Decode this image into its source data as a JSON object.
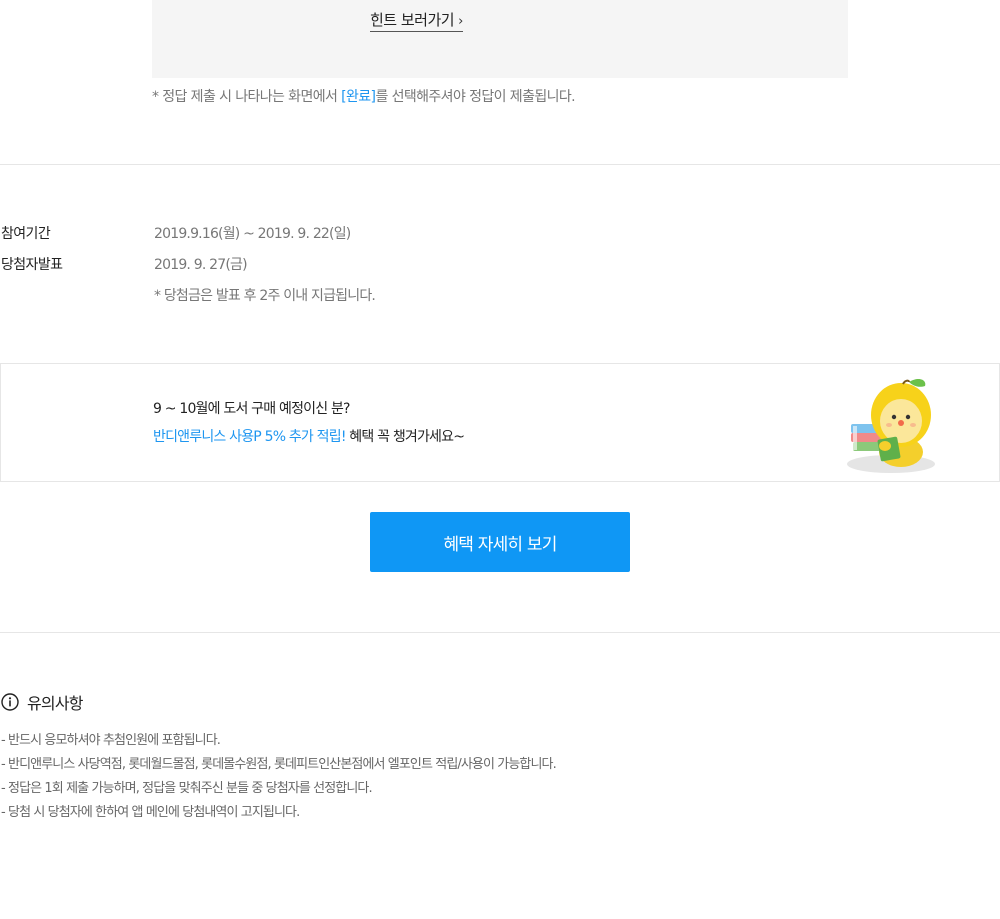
{
  "hint": {
    "link_label": "힌트 보러가기",
    "link_icon": "chevron-right-icon"
  },
  "submit_note": {
    "prefix": "* 정답 제출 시 나타나는 화면에서 ",
    "highlight": "[완료]",
    "suffix": "를 선택해주셔야 정답이 제출됩니다."
  },
  "schedule": {
    "period_label": "참여기간",
    "period_value": "2019.9.16(월) ~ 2019. 9. 22(일)",
    "announce_label": "당첨자발표",
    "announce_value": "2019. 9. 27(금)",
    "prize_note": "* 당첨금은 발표 후 2주 이내 지급됩니다."
  },
  "banner": {
    "line1": "9 ~ 10월에 도서 구매 예정이신 분?",
    "line2_highlight": "반디앤루니스 사용P 5% 추가 적립!",
    "line2_rest": " 혜택 꼭 챙겨가세요~",
    "mascot_icon": "lemon-mascot-with-books-icon"
  },
  "cta": {
    "label": "혜택 자세히 보기"
  },
  "notice": {
    "title": "유의사항",
    "icon": "info-circle-icon",
    "items": [
      "- 반드시 응모하셔야 추첨인원에 포함됩니다.",
      "- 반디앤루니스 사당역점, 롯데월드몰점, 롯데몰수원점, 롯데피트인산본점에서 엘포인트 적립/사용이 가능합니다.",
      "- 정답은 1회 제출 가능하며, 정답을 맞춰주신 분들 중 당첨자를 선정합니다.",
      "- 당첨 시 당첨자에 한하여 앱 메인에 당첨내역이 고지됩니다."
    ]
  },
  "colors": {
    "accent_blue": "#1e96f0",
    "cta_blue": "#0f97f5",
    "hint_bg": "#f5f5f5",
    "divider": "#e6e6e6"
  }
}
